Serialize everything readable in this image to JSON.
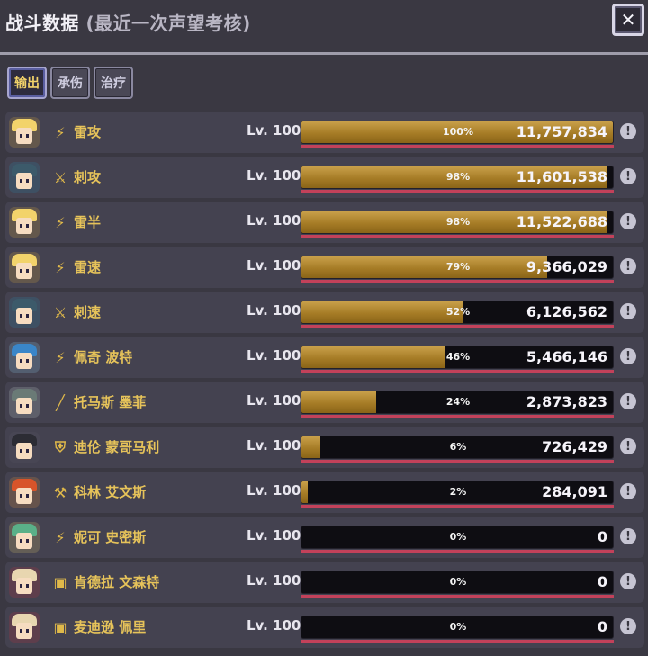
{
  "window": {
    "title": "战斗数据",
    "subtitle": "(最近一次声望考核)",
    "close_icon": "✕"
  },
  "tabs": [
    {
      "label": "输出",
      "active": true
    },
    {
      "label": "承伤",
      "active": false
    },
    {
      "label": "治疗",
      "active": false
    }
  ],
  "rows": [
    {
      "name": "雷攻",
      "level": "Lv. 100",
      "percent_label": "100%",
      "fill": 1.0,
      "damage": "11,757,834",
      "role_icon": "wand-icon",
      "role_glyph": "⚡",
      "avatar": {
        "hair": "#f2d36b",
        "accent": "#e6b43c"
      }
    },
    {
      "name": "刺攻",
      "level": "Lv. 100",
      "percent_label": "98%",
      "fill": 0.98,
      "damage": "11,601,538",
      "role_icon": "crossed-swords-icon",
      "role_glyph": "⚔",
      "avatar": {
        "hair": "#3c5a6a",
        "accent": "#2a8cb0"
      }
    },
    {
      "name": "雷半",
      "level": "Lv. 100",
      "percent_label": "98%",
      "fill": 0.98,
      "damage": "11,522,688",
      "role_icon": "wand-icon",
      "role_glyph": "⚡",
      "avatar": {
        "hair": "#f2d36b",
        "accent": "#e6b43c"
      }
    },
    {
      "name": "雷速",
      "level": "Lv. 100",
      "percent_label": "79%",
      "fill": 0.79,
      "damage": "9,366,029",
      "role_icon": "wand-icon",
      "role_glyph": "⚡",
      "avatar": {
        "hair": "#f2d36b",
        "accent": "#e6b43c"
      }
    },
    {
      "name": "刺速",
      "level": "Lv. 100",
      "percent_label": "52%",
      "fill": 0.52,
      "damage": "6,126,562",
      "role_icon": "crossed-swords-icon",
      "role_glyph": "⚔",
      "avatar": {
        "hair": "#3c5a6a",
        "accent": "#2a8cb0"
      }
    },
    {
      "name": "佩奇 波特",
      "level": "Lv. 100",
      "percent_label": "46%",
      "fill": 0.46,
      "damage": "5,466,146",
      "role_icon": "wand-icon",
      "role_glyph": "⚡",
      "avatar": {
        "hair": "#3a86c8",
        "accent": "#8fd0f0"
      }
    },
    {
      "name": "托马斯 墨菲",
      "level": "Lv. 100",
      "percent_label": "24%",
      "fill": 0.24,
      "damage": "2,873,823",
      "role_icon": "staff-icon",
      "role_glyph": "╱",
      "avatar": {
        "hair": "#6a7a76",
        "accent": "#c8d8d0"
      }
    },
    {
      "name": "迪伦 蒙哥马利",
      "level": "Lv. 100",
      "percent_label": "6%",
      "fill": 0.06,
      "damage": "726,429",
      "role_icon": "shield-icon",
      "role_glyph": "⛨",
      "avatar": {
        "hair": "#2c2c34",
        "accent": "#5a5a66"
      }
    },
    {
      "name": "科林 艾文斯",
      "level": "Lv. 100",
      "percent_label": "2%",
      "fill": 0.02,
      "damage": "284,091",
      "role_icon": "hammer-icon",
      "role_glyph": "⚒",
      "avatar": {
        "hair": "#d8542a",
        "accent": "#f29a3a"
      }
    },
    {
      "name": "妮可 史密斯",
      "level": "Lv. 100",
      "percent_label": "0%",
      "fill": 0.0,
      "damage": "0",
      "role_icon": "wand-icon",
      "role_glyph": "⚡",
      "avatar": {
        "hair": "#5ab088",
        "accent": "#e6d070"
      }
    },
    {
      "name": "肯德拉 文森特",
      "level": "Lv. 100",
      "percent_label": "0%",
      "fill": 0.0,
      "damage": "0",
      "role_icon": "book-icon",
      "role_glyph": "▣",
      "avatar": {
        "hair": "#e8d6b0",
        "accent": "#c8323a"
      }
    },
    {
      "name": "麦迪逊 佩里",
      "level": "Lv. 100",
      "percent_label": "0%",
      "fill": 0.0,
      "damage": "0",
      "role_icon": "book-icon",
      "role_glyph": "▣",
      "avatar": {
        "hair": "#e8d6b0",
        "accent": "#c8323a"
      }
    }
  ],
  "info_glyph": "!"
}
